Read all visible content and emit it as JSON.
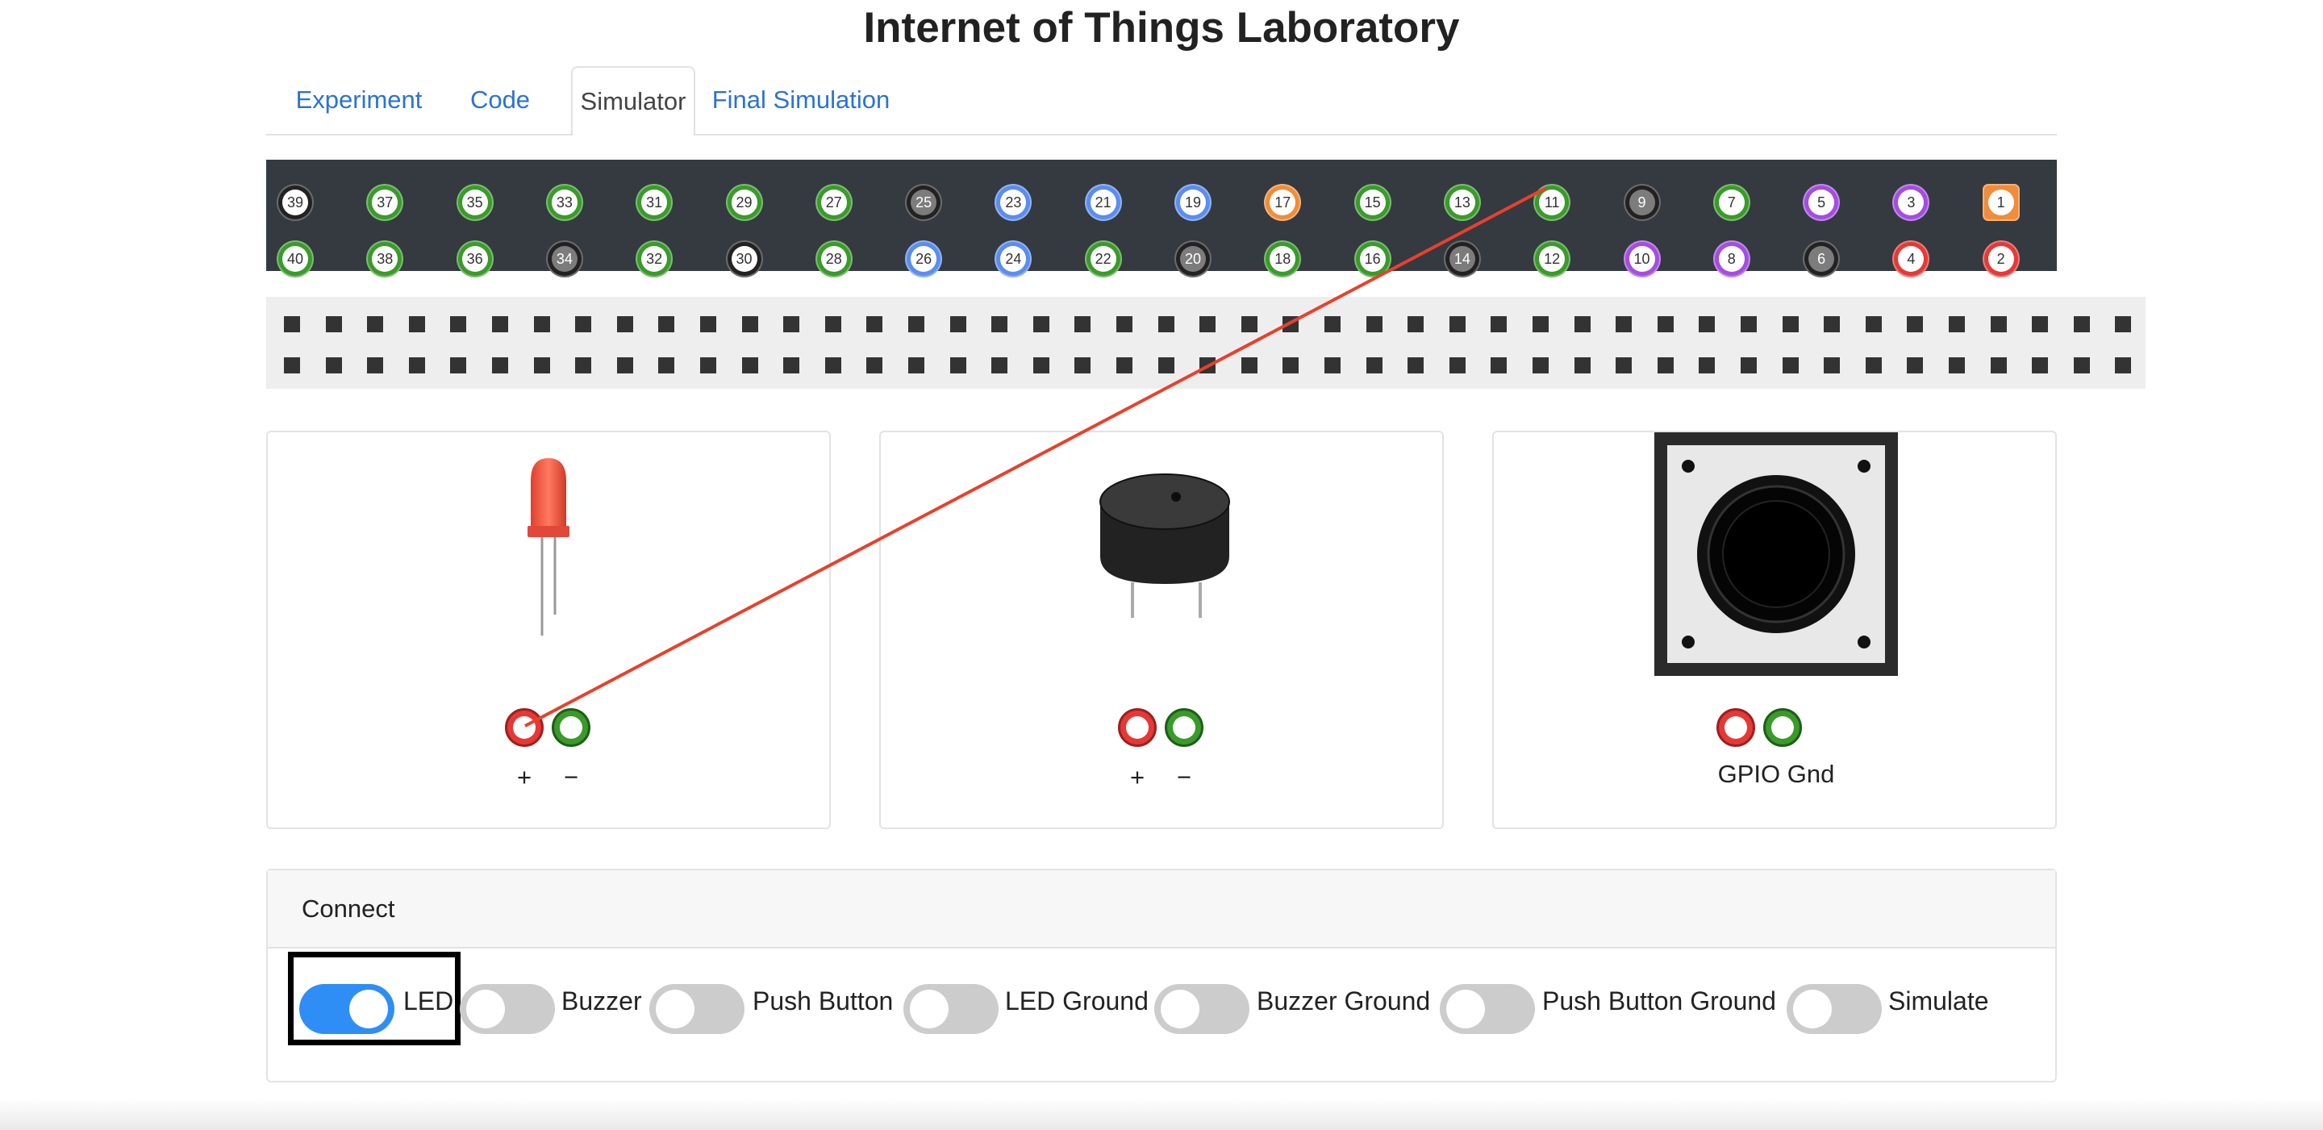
{
  "page": {
    "title": "Internet of Things Laboratory"
  },
  "tabs": [
    {
      "label": "Experiment",
      "active": false
    },
    {
      "label": "Code",
      "active": false
    },
    {
      "label": "Simulator",
      "active": true
    },
    {
      "label": "Final Simulation",
      "active": false
    }
  ],
  "gpio": {
    "top_row": [
      {
        "num": "39",
        "color": "#222222"
      },
      {
        "num": "37",
        "color": "#3a9a2a"
      },
      {
        "num": "35",
        "color": "#3a9a2a"
      },
      {
        "num": "33",
        "color": "#3a9a2a"
      },
      {
        "num": "31",
        "color": "#3a9a2a"
      },
      {
        "num": "29",
        "color": "#3a9a2a"
      },
      {
        "num": "27",
        "color": "#3a9a2a"
      },
      {
        "num": "25",
        "color": "#222222",
        "gray": true
      },
      {
        "num": "23",
        "color": "#5b8def"
      },
      {
        "num": "21",
        "color": "#5b8def"
      },
      {
        "num": "19",
        "color": "#5b8def"
      },
      {
        "num": "17",
        "color": "#f08c3a"
      },
      {
        "num": "15",
        "color": "#3a9a2a"
      },
      {
        "num": "13",
        "color": "#3a9a2a"
      },
      {
        "num": "11",
        "color": "#3a9a2a"
      },
      {
        "num": "9",
        "color": "#222222",
        "gray": true
      },
      {
        "num": "7",
        "color": "#3a9a2a"
      },
      {
        "num": "5",
        "color": "#a44de0"
      },
      {
        "num": "3",
        "color": "#a44de0"
      },
      {
        "num": "1",
        "color": "#f08c3a",
        "square": true
      }
    ],
    "bottom_row": [
      {
        "num": "40",
        "color": "#3a9a2a"
      },
      {
        "num": "38",
        "color": "#3a9a2a"
      },
      {
        "num": "36",
        "color": "#3a9a2a"
      },
      {
        "num": "34",
        "color": "#222222",
        "gray": true
      },
      {
        "num": "32",
        "color": "#3a9a2a"
      },
      {
        "num": "30",
        "color": "#222222"
      },
      {
        "num": "28",
        "color": "#3a9a2a"
      },
      {
        "num": "26",
        "color": "#5b8def"
      },
      {
        "num": "24",
        "color": "#5b8def"
      },
      {
        "num": "22",
        "color": "#3a9a2a"
      },
      {
        "num": "20",
        "color": "#222222",
        "gray": true
      },
      {
        "num": "18",
        "color": "#3a9a2a"
      },
      {
        "num": "16",
        "color": "#3a9a2a"
      },
      {
        "num": "14",
        "color": "#222222",
        "gray": true
      },
      {
        "num": "12",
        "color": "#3a9a2a"
      },
      {
        "num": "10",
        "color": "#a44de0"
      },
      {
        "num": "8",
        "color": "#a44de0"
      },
      {
        "num": "6",
        "color": "#222222",
        "gray": true
      },
      {
        "num": "4",
        "color": "#e53935"
      },
      {
        "num": "2",
        "color": "#e53935"
      }
    ]
  },
  "components": {
    "led": {
      "plus": "+",
      "minus": "−"
    },
    "buzzer": {
      "plus": "+",
      "minus": "−"
    },
    "push_button": {
      "pins_label": "GPIO Gnd"
    }
  },
  "connect": {
    "title": "Connect",
    "switches": [
      {
        "label": "LED",
        "on": true
      },
      {
        "label": "Buzzer",
        "on": false
      },
      {
        "label": "Push Button",
        "on": false
      },
      {
        "label": "LED Ground",
        "on": false
      },
      {
        "label": "Buzzer Ground",
        "on": false
      },
      {
        "label": "Push Button Ground",
        "on": false
      },
      {
        "label": "Simulate",
        "on": false
      }
    ]
  },
  "wire": {
    "color": "#e8412c",
    "from": "pin 11",
    "to": "LED +"
  }
}
